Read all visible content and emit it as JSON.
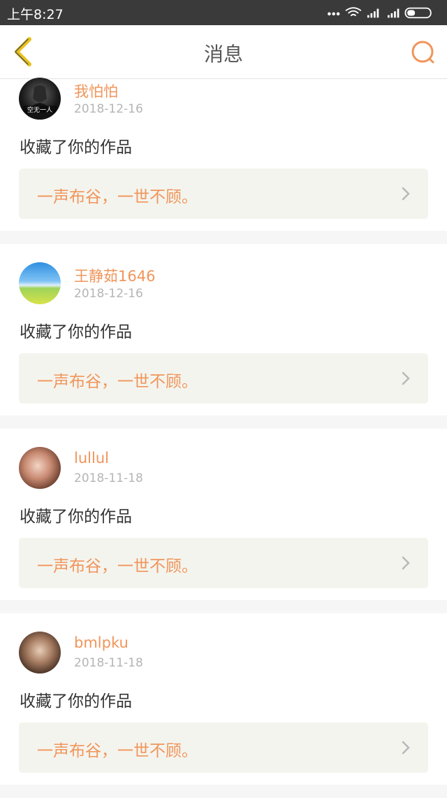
{
  "status_bar": {
    "time": "上午8:27",
    "icons": [
      "more-dots-icon",
      "wifi-icon",
      "signal-icon",
      "signal-icon",
      "battery-icon"
    ]
  },
  "header": {
    "title": "消息",
    "back_icon": "chevron-left-icon",
    "search_icon": "search-icon"
  },
  "colors": {
    "accent": "#f0955a",
    "back_arrow": "#e8c21a",
    "background": "#f6f6f6"
  },
  "messages": [
    {
      "username": "我怕怕",
      "date": "2018-12-16",
      "action": "收藏了你的作品",
      "work_title": "一声布谷，一世不顾。",
      "avatar_caption": "空无一人"
    },
    {
      "username": "王静茹1646",
      "date": "2018-12-16",
      "action": "收藏了你的作品",
      "work_title": "一声布谷，一世不顾。"
    },
    {
      "username": "lullul",
      "date": "2018-11-18",
      "action": "收藏了你的作品",
      "work_title": "一声布谷，一世不顾。"
    },
    {
      "username": "bmlpku",
      "date": "2018-11-18",
      "action": "收藏了你的作品",
      "work_title": "一声布谷，一世不顾。"
    }
  ]
}
